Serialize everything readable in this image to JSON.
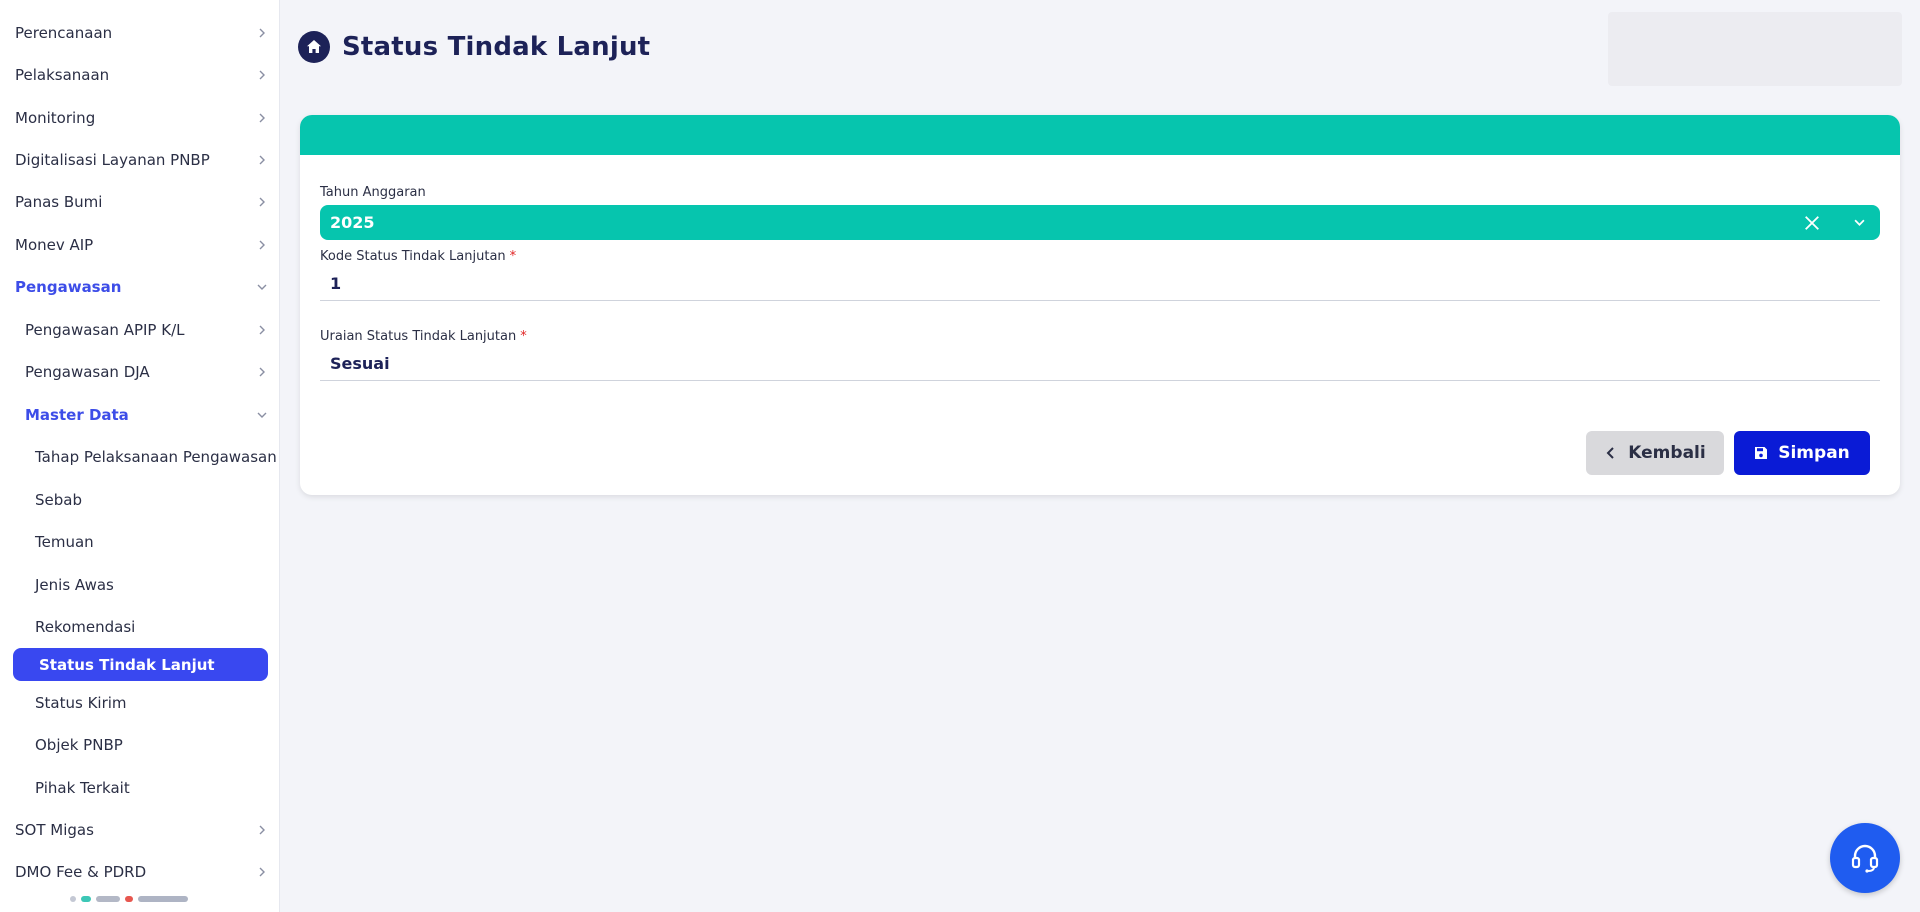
{
  "sidebar": {
    "items": [
      {
        "label": "Perencanaan"
      },
      {
        "label": "Pelaksanaan"
      },
      {
        "label": "Monitoring"
      },
      {
        "label": "Digitalisasi Layanan PNBP"
      },
      {
        "label": "Panas Bumi"
      },
      {
        "label": "Monev AIP"
      },
      {
        "label": "Pengawasan"
      },
      {
        "label": "Pengawasan APIP K/L"
      },
      {
        "label": "Pengawasan DJA"
      },
      {
        "label": "Master Data"
      },
      {
        "label": "Tahap Pelaksanaan Pengawasan"
      },
      {
        "label": "Sebab"
      },
      {
        "label": "Temuan"
      },
      {
        "label": "Jenis Awas"
      },
      {
        "label": "Rekomendasi"
      },
      {
        "label": "Status Tindak Lanjut"
      },
      {
        "label": "Status Kirim"
      },
      {
        "label": "Objek PNBP"
      },
      {
        "label": "Pihak Terkait"
      },
      {
        "label": "SOT Migas"
      },
      {
        "label": "DMO Fee & PDRD"
      }
    ]
  },
  "header": {
    "title": "Status Tindak Lanjut"
  },
  "form": {
    "tahun_label": "Tahun Anggaran",
    "tahun_value": "2025",
    "kode_label": "Kode Status Tindak Lanjutan",
    "kode_value": "1",
    "uraian_label": "Uraian Status Tindak Lanjutan",
    "uraian_value": "Sesuai",
    "required_mark": "*"
  },
  "buttons": {
    "back_label": "Kembali",
    "save_label": "Simpan"
  },
  "colors": {
    "accent_teal": "#06c5ae",
    "active_nav": "#3948f0",
    "save_button": "#0a1bd6",
    "title": "#1d2258"
  }
}
